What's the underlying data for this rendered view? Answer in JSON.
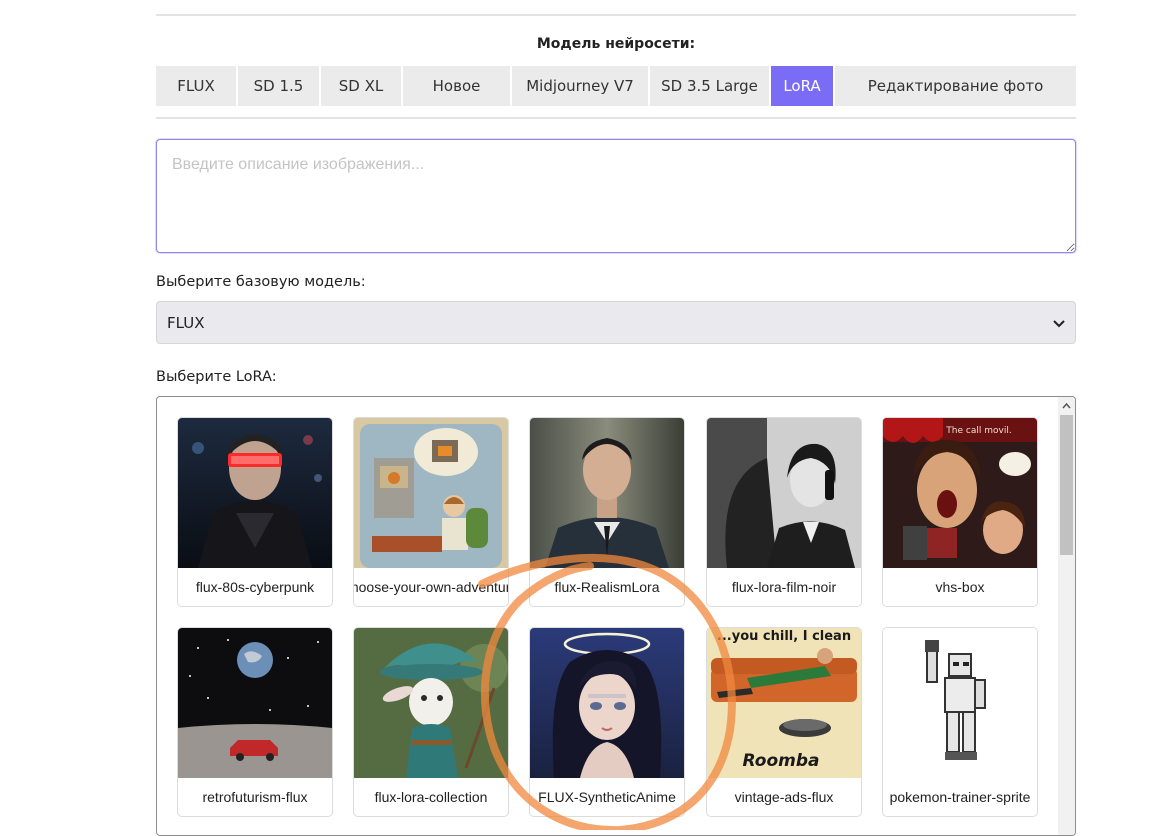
{
  "header": {
    "model_title": "Модель нейросети:",
    "tabs": [
      {
        "label": "FLUX",
        "active": false
      },
      {
        "label": "SD 1.5",
        "active": false
      },
      {
        "label": "SD XL",
        "active": false
      },
      {
        "label": "Новое",
        "active": false
      },
      {
        "label": "Midjourney V7",
        "active": false
      },
      {
        "label": "SD 3.5 Large",
        "active": false
      },
      {
        "label": "LoRA",
        "active": true
      },
      {
        "label": "Редактирование фото",
        "active": false
      }
    ]
  },
  "prompt": {
    "placeholder": "Введите описание изображения...",
    "value": ""
  },
  "base_model": {
    "label": "Выберите базовую модель:",
    "selected": "FLUX"
  },
  "lora": {
    "label": "Выберите LoRA:",
    "items": [
      {
        "name": "flux-80s-cyberpunk"
      },
      {
        "name": "choose-your-own-adventure"
      },
      {
        "name": "flux-RealismLora"
      },
      {
        "name": "flux-lora-film-noir"
      },
      {
        "name": "vhs-box"
      },
      {
        "name": "retrofuturism-flux"
      },
      {
        "name": "flux-lora-collection"
      },
      {
        "name": "FLUX-SyntheticAnime"
      },
      {
        "name": "vintage-ads-flux"
      },
      {
        "name": "pokemon-trainer-sprite"
      }
    ],
    "thumb_text": {
      "vhs_title": "The call movil.",
      "ad_headline": "...you chill, I clean",
      "ad_brand": "Roomba"
    }
  },
  "colors": {
    "accent": "#7b6cf6",
    "annotation": "#f0883e"
  }
}
